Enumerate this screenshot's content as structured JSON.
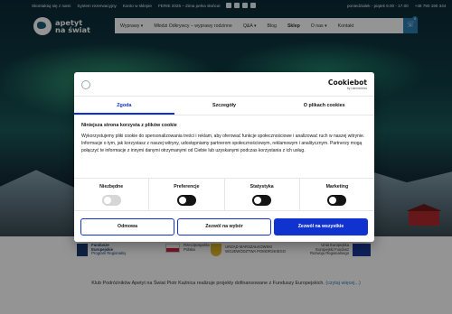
{
  "topbar": {
    "links": [
      "Skontaktuj się z nami",
      "System rezerwacyjny",
      "Konto w sklepie",
      "FERIE 2025 – Zima pełna słońca!"
    ],
    "right": [
      "poniedziałek - piątek 9.00 - 17.00",
      "+48 790 190 344"
    ]
  },
  "logo": {
    "line1": "apetyt",
    "line2": "na świat"
  },
  "nav": {
    "items": [
      "Wyprawy ▾",
      "Młodzi Odkrywcy – wyprawy rodzinne",
      "Q&A ▾",
      "Blog",
      "Sklep",
      "O nas ▾",
      "Kontakt"
    ],
    "active": "Sklep",
    "cart_count": "0"
  },
  "cookie": {
    "brand": "Cookiebot",
    "brand_by": "by Usercentrics",
    "tabs": [
      "Zgoda",
      "Szczegóły",
      "O plikach cookies"
    ],
    "active_tab": "Zgoda",
    "heading": "Niniejsza strona korzysta z plików cookie",
    "body": "Wykorzystujemy pliki cookie do spersonalizowania treści i reklam, aby oferować funkcje społecznościowe i analizować ruch w naszej witrynie. Informacje o tym, jak korzystasz z naszej witryny, udostępniamy partnerom społecznościowym, reklamowym i analitycznym. Partnerzy mogą połączyć te informacje z innymi danymi otrzymanymi od Ciebie lub uzyskanymi podczas korzystania z ich usług.",
    "toggles": [
      {
        "label": "Niezbędne",
        "state": "disabled"
      },
      {
        "label": "Preferencje",
        "state": "off"
      },
      {
        "label": "Statystyka",
        "state": "off"
      },
      {
        "label": "Marketing",
        "state": "off"
      }
    ],
    "buttons": {
      "deny": "Odmowa",
      "selection": "Zezwól na wybór",
      "allow_all": "Zezwól na wszystkie"
    }
  },
  "funding": {
    "logos": [
      {
        "line1": "Fundusze",
        "line2": "Europejskie",
        "line3": "Program Regionalny"
      },
      {
        "line1": "Rzeczpospolita",
        "line2": "Polska"
      },
      {
        "line1": "URZĄD MARSZAŁKOWSKI",
        "line2": "WOJEWÓDZTWA POMORSKIEGO"
      },
      {
        "line1": "Unia Europejska",
        "line2": "Europejski Fundusz",
        "line3": "Rozwoju Regionalnego"
      }
    ],
    "text": "Klub Podróżników Apetyt na Świat Piotr Kaźnica realizuje projekty dofinansowane z Funduszy Europejskich.",
    "link": "(czytaj więcej...)"
  },
  "colors": {
    "accent": "#1032cf",
    "site_blue": "#2a7fb6"
  }
}
